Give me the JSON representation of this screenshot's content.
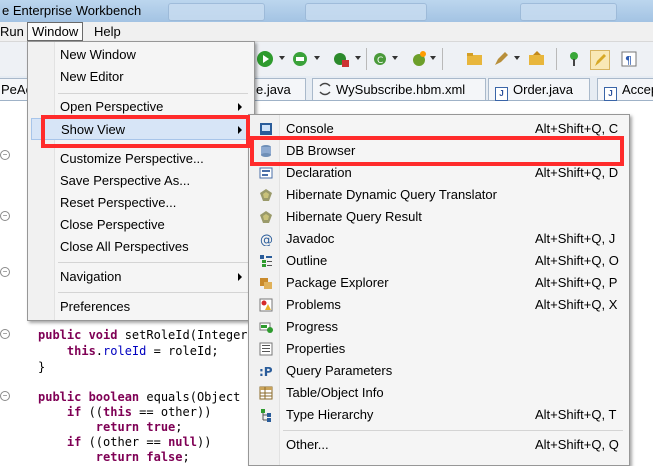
{
  "window": {
    "title": "e Enterprise Workbench"
  },
  "menubar": {
    "items": [
      "Run",
      "Window",
      "Help"
    ]
  },
  "editor_tabs": [
    {
      "label": "PeAc"
    },
    {
      "label": "e.java"
    },
    {
      "label": "WySubscribe.hbm.xml"
    },
    {
      "label": "Order.java"
    },
    {
      "label": "Accep"
    }
  ],
  "window_menu": {
    "items": [
      {
        "label": "New Window"
      },
      {
        "label": "New Editor"
      },
      {
        "label": "Open Perspective",
        "submenu": true
      },
      {
        "label": "Show View",
        "submenu": true,
        "highlighted": true
      },
      {
        "label": "Customize Perspective..."
      },
      {
        "label": "Save Perspective As..."
      },
      {
        "label": "Reset Perspective..."
      },
      {
        "label": "Close Perspective"
      },
      {
        "label": "Close All Perspectives"
      },
      {
        "label": "Navigation",
        "submenu": true
      },
      {
        "label": "Preferences"
      }
    ]
  },
  "show_view_menu": {
    "items": [
      {
        "label": "Console",
        "accel": "Alt+Shift+Q, C",
        "icon": "console-icon"
      },
      {
        "label": "DB Browser",
        "accel": "",
        "icon": "db-browser-icon",
        "highlighted": true
      },
      {
        "label": "Declaration",
        "accel": "Alt+Shift+Q, D",
        "icon": "declaration-icon"
      },
      {
        "label": "Hibernate Dynamic Query Translator",
        "accel": "",
        "icon": "hibernate-icon"
      },
      {
        "label": "Hibernate Query Result",
        "accel": "",
        "icon": "hibernate-icon"
      },
      {
        "label": "Javadoc",
        "accel": "Alt+Shift+Q, J",
        "icon": "javadoc-icon"
      },
      {
        "label": "Outline",
        "accel": "Alt+Shift+Q, O",
        "icon": "outline-icon"
      },
      {
        "label": "Package Explorer",
        "accel": "Alt+Shift+Q, P",
        "icon": "package-explorer-icon"
      },
      {
        "label": "Problems",
        "accel": "Alt+Shift+Q, X",
        "icon": "problems-icon"
      },
      {
        "label": "Progress",
        "accel": "",
        "icon": "progress-icon"
      },
      {
        "label": "Properties",
        "accel": "",
        "icon": "properties-icon"
      },
      {
        "label": "Query Parameters",
        "accel": "",
        "icon": "query-parameters-icon"
      },
      {
        "label": "Table/Object Info",
        "accel": "",
        "icon": "table-icon"
      },
      {
        "label": "Type Hierarchy",
        "accel": "Alt+Shift+Q, T",
        "icon": "type-hierarchy-icon"
      },
      {
        "label": "Other...",
        "accel": "Alt+Shift+Q, Q",
        "icon": ""
      }
    ]
  },
  "code": {
    "lines": [
      {
        "parts": [
          {
            "t": "public void ",
            "c": "kw"
          },
          {
            "t": "setRoleId(Integer",
            "c": ""
          }
        ]
      },
      {
        "parts": [
          {
            "t": "    this",
            "c": "kw"
          },
          {
            "t": ".",
            "c": ""
          },
          {
            "t": "roleId",
            "c": "fld"
          },
          {
            "t": " = roleId;",
            "c": ""
          }
        ]
      },
      {
        "parts": [
          {
            "t": "}",
            "c": ""
          }
        ]
      },
      {
        "parts": [
          {
            "t": "",
            "c": ""
          }
        ]
      },
      {
        "parts": [
          {
            "t": "public boolean ",
            "c": "kw"
          },
          {
            "t": "equals(Object o",
            "c": ""
          }
        ]
      },
      {
        "parts": [
          {
            "t": "    if",
            "c": "kw"
          },
          {
            "t": " ((",
            "c": ""
          },
          {
            "t": "this",
            "c": "kw"
          },
          {
            "t": " == other))",
            "c": ""
          }
        ]
      },
      {
        "parts": [
          {
            "t": "        return true",
            "c": "kw"
          },
          {
            "t": ";",
            "c": ""
          }
        ]
      },
      {
        "parts": [
          {
            "t": "    if",
            "c": "kw"
          },
          {
            "t": " ((other == ",
            "c": ""
          },
          {
            "t": "null",
            "c": "kw"
          },
          {
            "t": "))",
            "c": ""
          }
        ]
      },
      {
        "parts": [
          {
            "t": "        return false",
            "c": "kw"
          },
          {
            "t": ";",
            "c": ""
          }
        ]
      }
    ]
  },
  "colors": {
    "highlight_box": "#ff2b2b",
    "menu_hover": "#d7e5f7",
    "keyword": "#7f0055",
    "field": "#0000c0"
  }
}
